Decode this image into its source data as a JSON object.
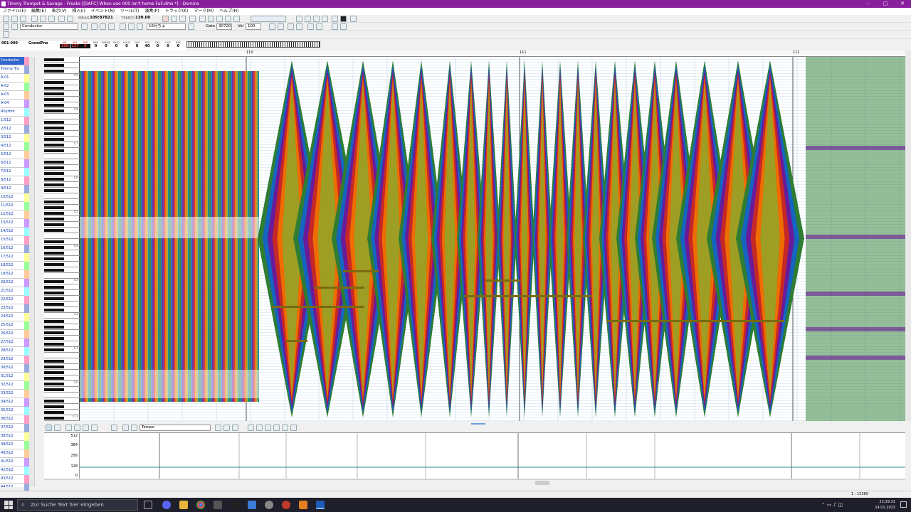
{
  "window": {
    "title": "Timmy Trumpet & Savage - Freaks [[SAFC] When ooo 000 isn't home Full.dms *] - Domino",
    "controls": [
      "–",
      "▢",
      "✕"
    ]
  },
  "menu": [
    "ファイル(F)",
    "編集(E)",
    "表示(V)",
    "挿入(I)",
    "イベント(N)",
    "ツール(T)",
    "演奏(P)",
    "トラック(K)",
    "マーク(M)",
    "ヘルプ(H)"
  ],
  "toolbar1": {
    "meas_label": "MEAS",
    "meas_value": "109:87821",
    "tempo_label": "TEMPO",
    "tempo_value": "130.00"
  },
  "toolbar2": {
    "track_select": "Conductor",
    "gate_label": "Gate",
    "gate_value": "30720",
    "vel_label": "Vel",
    "vel_value": "100",
    "note_select": "16分ちょ"
  },
  "info": {
    "position": "001-000",
    "instrument": "GrandPno",
    "meter_headers": [
      "VEL",
      "VOL",
      "EXP",
      "PAN",
      "P.BEND",
      "MOD",
      "HOLD",
      "CHO",
      "REV",
      "DEL",
      "CUT",
      "RES"
    ],
    "meter_values": [
      "100",
      "127",
      "0",
      "0",
      "0",
      "0",
      "0",
      "0",
      "40",
      "0",
      "0",
      "0"
    ]
  },
  "ruler": {
    "bars": [
      "110",
      "111",
      "112"
    ]
  },
  "tracks": [
    "Conductor",
    "Timmy Tru",
    "A-01",
    "A-02",
    "A-03",
    "A-04",
    "Rhythm",
    "1/512",
    "2/512",
    "3/512",
    "4/512",
    "5/512",
    "6/512",
    "7/512",
    "8/512",
    "9/512",
    "10/512",
    "11/512",
    "12/512",
    "13/512",
    "14/512",
    "15/512",
    "16/512",
    "17/512",
    "18/512",
    "19/512",
    "20/512",
    "21/512",
    "22/512",
    "23/512",
    "24/512",
    "25/512",
    "26/512",
    "27/512",
    "28/512",
    "29/512",
    "30/512",
    "31/512",
    "32/512",
    "33/512",
    "34/512",
    "35/512",
    "36/512",
    "37/512",
    "38/512",
    "39/512",
    "40/512",
    "41/512",
    "42/512",
    "43/512",
    "44/512",
    "45/512"
  ],
  "piano_octaves": [
    "C9",
    "C8",
    "C7",
    "C6",
    "C5",
    "C4",
    "C3",
    "C2",
    "C1",
    "C0",
    "C-1"
  ],
  "controller": {
    "type": "Tempo",
    "axis": [
      "512",
      "384",
      "256",
      "128",
      "0"
    ]
  },
  "status": {
    "zoom": "1 : 15360"
  },
  "taskbar": {
    "search_placeholder": "Zur Suche Text hier eingeben",
    "time": "22:29:31",
    "date": "14.01.2023"
  },
  "colors": {
    "title_bar": "#8a1f9e",
    "taskbar": "#1e1f2a",
    "note_palette": [
      "#2e7d32",
      "#1565c0",
      "#6a1b9a",
      "#c62828",
      "#ef6c00",
      "#9e9d24",
      "#00838f"
    ]
  }
}
